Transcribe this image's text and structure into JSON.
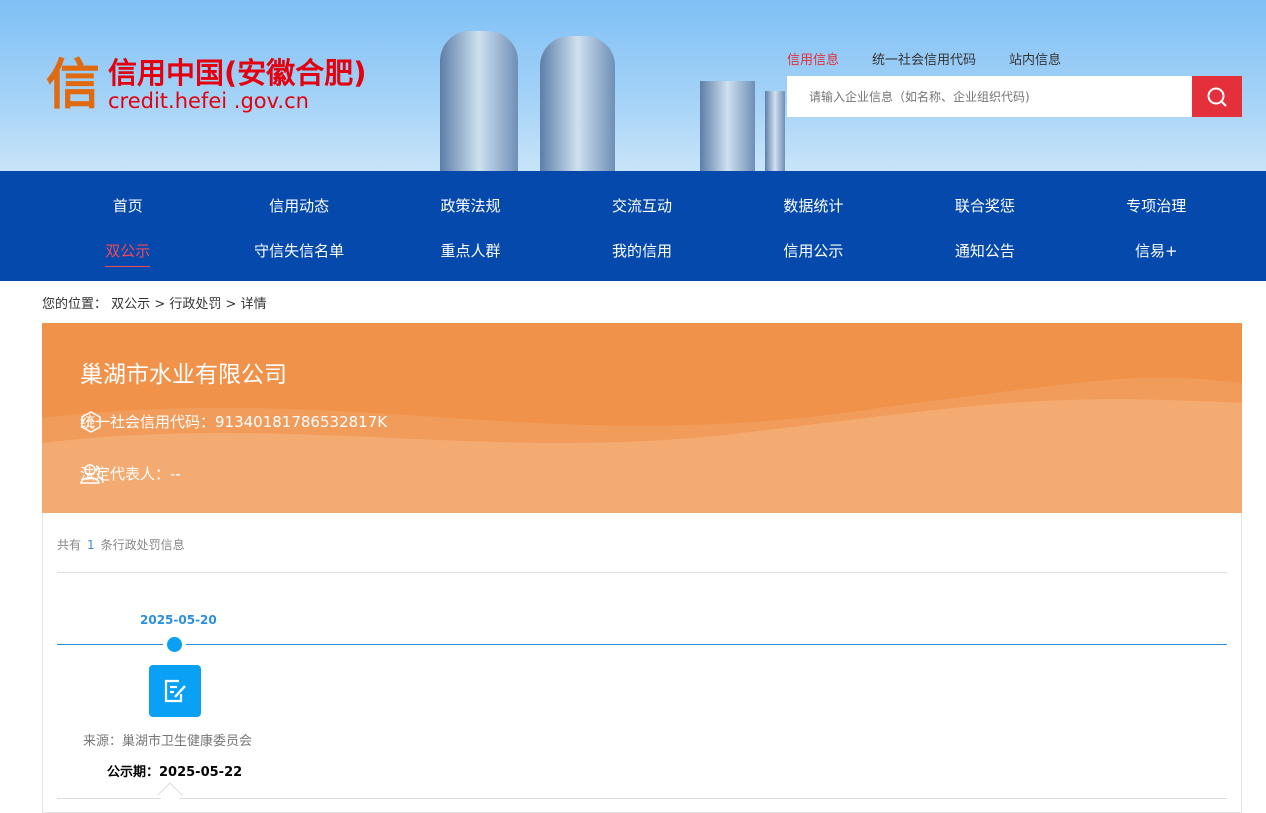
{
  "header": {
    "logo_title": "信用中国(安徽合肥)",
    "logo_url": "credit.hefei .gov.cn",
    "top_links": [
      "信用信息",
      "统一社会信用代码",
      "站内信息"
    ],
    "search_placeholder": "请输入企业信息（如名称、企业组织代码)"
  },
  "nav": {
    "row1": [
      "首页",
      "信用动态",
      "政策法规",
      "交流互动",
      "数据统计",
      "联合奖惩",
      "专项治理"
    ],
    "row2": [
      "双公示",
      "守信失信名单",
      "重点人群",
      "我的信用",
      "信用公示",
      "通知公告",
      "信易+"
    ]
  },
  "breadcrumb": {
    "label": "您的位置：",
    "items": [
      "双公示",
      "行政处罚",
      "详情"
    ],
    "sep": ">"
  },
  "company": {
    "name": "巢湖市水业有限公司",
    "credit_code": "统一社会信用代码：91340181786532817K",
    "legal_rep": "法定代表人：--"
  },
  "records": {
    "prefix": "共有",
    "count": "1",
    "suffix": "条行政处罚信息",
    "items": [
      {
        "date": "2025-05-20",
        "source": "来源：巢湖市卫生健康委员会",
        "publicity": "公示期：2025-05-22"
      }
    ]
  },
  "colors": {
    "nav": "#0449ab",
    "accent": "#e3303a",
    "hero": "#f0924a",
    "timeline": "#0aa0f5"
  }
}
